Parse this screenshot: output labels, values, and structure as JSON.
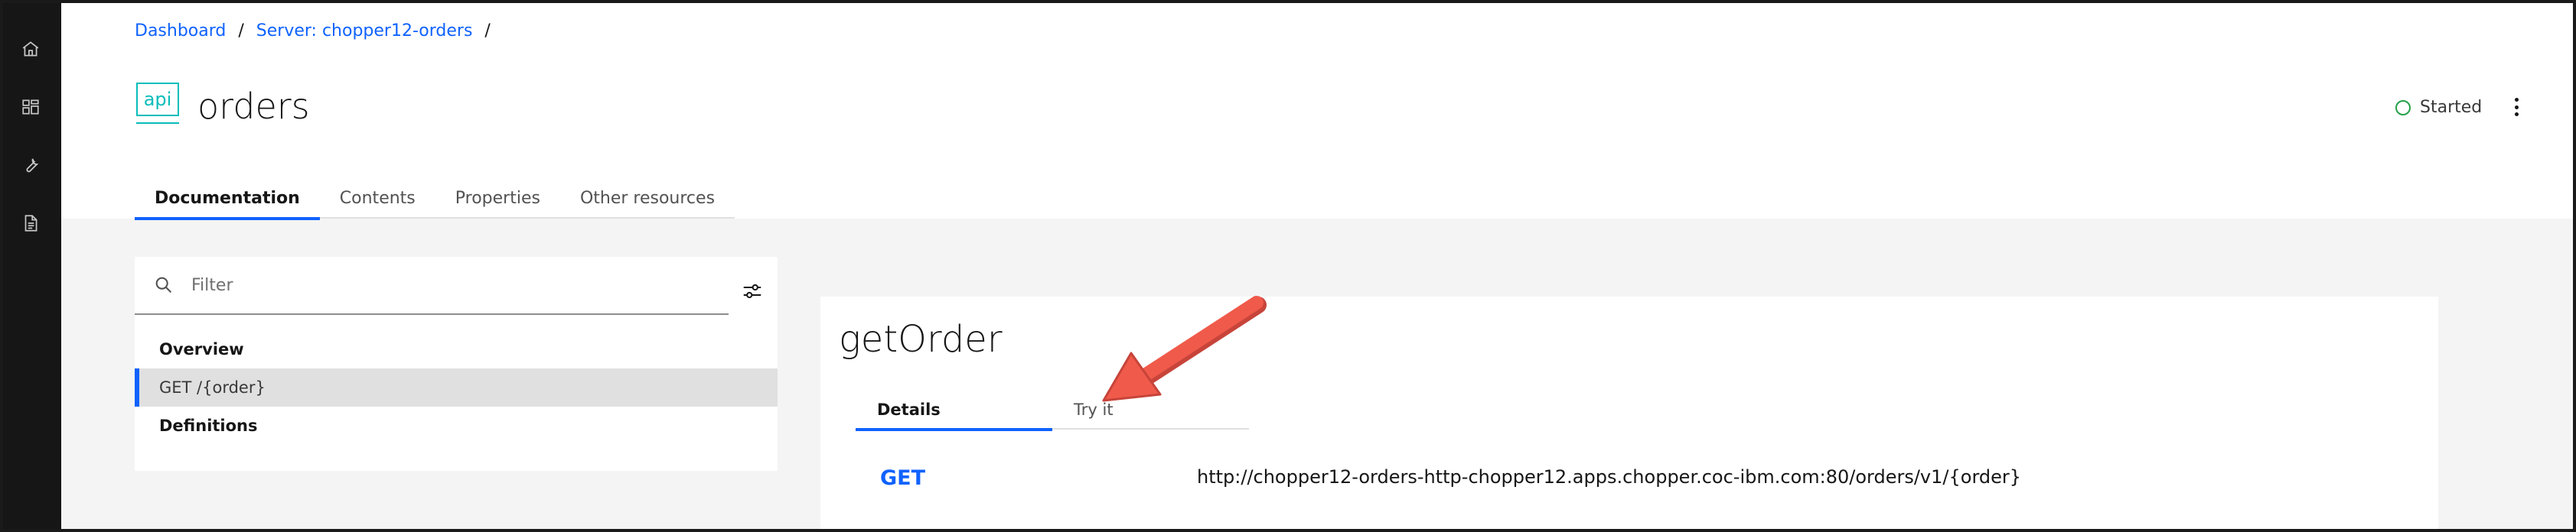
{
  "breadcrumbs": [
    {
      "label": "Dashboard"
    },
    {
      "label": "Server: chopper12-orders"
    }
  ],
  "breadcrumb_separator": "/",
  "api_icon_label": "api",
  "page_title": "orders",
  "status": {
    "label": "Started",
    "color": "#24a148"
  },
  "tabs": [
    {
      "label": "Documentation",
      "active": true
    },
    {
      "label": "Contents",
      "active": false
    },
    {
      "label": "Properties",
      "active": false
    },
    {
      "label": "Other resources",
      "active": false
    }
  ],
  "filter": {
    "placeholder": "Filter",
    "value": ""
  },
  "sidebar_items": [
    {
      "label": "Overview"
    },
    {
      "label": "GET /{order}",
      "selected": true
    },
    {
      "label": "Definitions"
    }
  ],
  "operation": {
    "title": "getOrder",
    "tabs": [
      {
        "label": "Details",
        "active": true
      },
      {
        "label": "Try it",
        "active": false
      }
    ],
    "method": "GET",
    "url": "http://chopper12-orders-http-chopper12.apps.chopper.coc-ibm.com:80/orders/v1/{order}"
  },
  "colors": {
    "accent": "#0f62fe",
    "api_teal": "#08bdba",
    "annotation_arrow": "#f05a4a",
    "rail": "#161616"
  },
  "icons": [
    "home-icon",
    "dashboard-icon",
    "wrench-icon",
    "document-icon",
    "search-icon",
    "settings-adjust-icon",
    "overflow-menu-icon"
  ]
}
